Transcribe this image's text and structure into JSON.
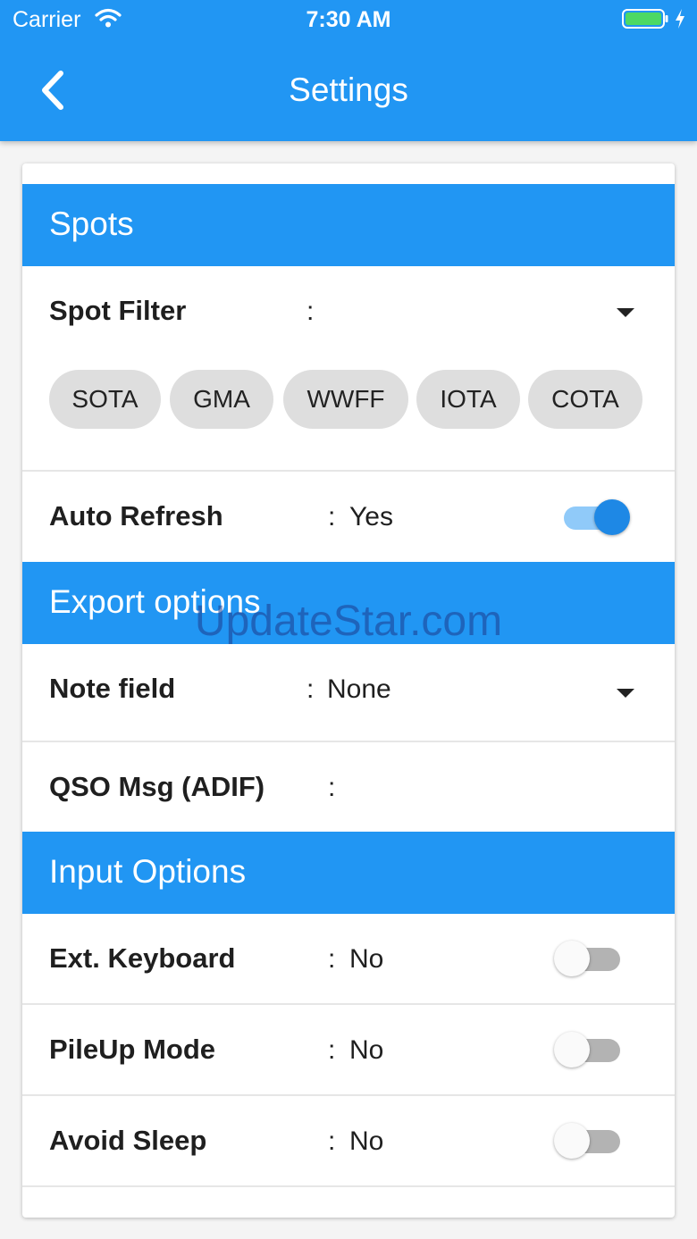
{
  "status_bar": {
    "carrier": "Carrier",
    "time": "7:30 AM"
  },
  "nav": {
    "title": "Settings"
  },
  "sections": {
    "spots": "Spots",
    "export": "Export options",
    "input": "Input Options"
  },
  "spot_filter": {
    "label": "Spot Filter",
    "colon": ":",
    "chips": [
      "SOTA",
      "GMA",
      "WWFF",
      "IOTA",
      "COTA"
    ]
  },
  "auto_refresh": {
    "label": "Auto Refresh",
    "colon": ":",
    "value": "Yes",
    "enabled": true
  },
  "note_field": {
    "label": "Note field",
    "colon": ":",
    "value": "None"
  },
  "qso_msg": {
    "label": "QSO Msg (ADIF)",
    "colon": ":"
  },
  "ext_keyboard": {
    "label": "Ext. Keyboard",
    "colon": ":",
    "value": "No",
    "enabled": false
  },
  "pileup_mode": {
    "label": "PileUp Mode",
    "colon": ":",
    "value": "No",
    "enabled": false
  },
  "avoid_sleep": {
    "label": "Avoid Sleep",
    "colon": ":",
    "value": "No",
    "enabled": false
  },
  "watermark": "UpdateStar.com",
  "colors": {
    "primary": "#2196f3",
    "toggle_on": "#1e88e5",
    "chip_bg": "#dedede"
  }
}
